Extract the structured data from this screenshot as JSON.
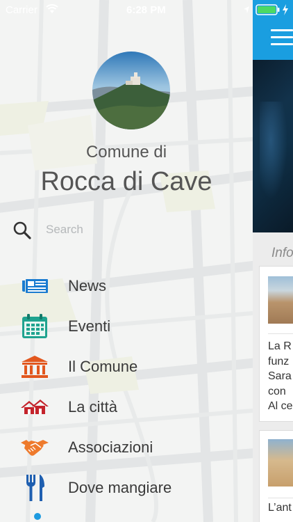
{
  "status": {
    "carrier": "Carrier",
    "time": "6:28 PM"
  },
  "header": {
    "subtitle": "Comune di",
    "title": "Rocca di Cave"
  },
  "search": {
    "placeholder": "Search"
  },
  "menu": {
    "items": [
      {
        "label": "News",
        "icon": "newspaper-icon",
        "color": "#1a7bd0"
      },
      {
        "label": "Eventi",
        "icon": "calendar-icon",
        "color": "#1fa38f"
      },
      {
        "label": "Il Comune",
        "icon": "town-hall-icon",
        "color": "#e2571e"
      },
      {
        "label": "La città",
        "icon": "city-houses-icon",
        "color": "#c4232b"
      },
      {
        "label": "Associazioni",
        "icon": "handshake-icon",
        "color": "#ee7a2c"
      },
      {
        "label": "Dove mangiare",
        "icon": "fork-knife-icon",
        "color": "#1f5fb0"
      }
    ]
  },
  "main": {
    "section_label": "Info",
    "cards": [
      {
        "text": "La R\nfunz\nSara\ncon \nAl ce"
      },
      {
        "text": "L’ant"
      }
    ]
  },
  "colors": {
    "accent": "#1a9ee0",
    "text": "#555555"
  }
}
